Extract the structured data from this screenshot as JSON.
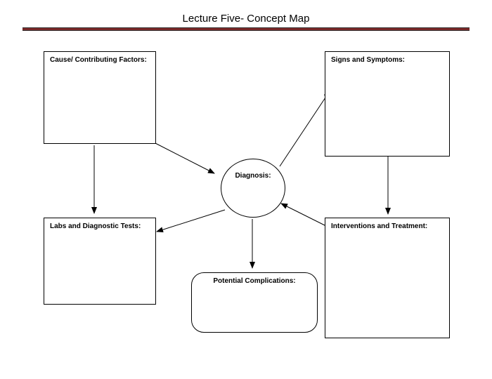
{
  "title": "Lecture Five- Concept Map",
  "boxes": {
    "cause": "Cause/ Contributing Factors:",
    "signs": "Signs and Symptoms:",
    "diagnosis": "Diagnosis:",
    "labs": "Labs and Diagnostic Tests:",
    "interventions": "Interventions and Treatment:",
    "complications": "Potential Complications:"
  }
}
